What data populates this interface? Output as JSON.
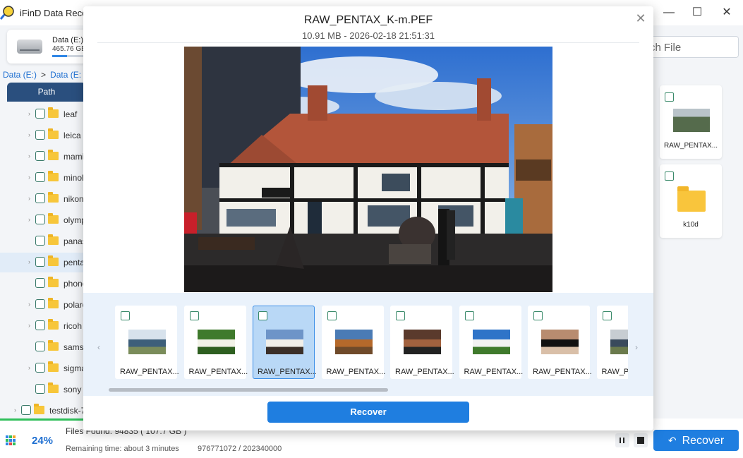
{
  "app": {
    "title": "iFinD Data Recov",
    "window_controls": {
      "minimize": "—",
      "maximize": "☐",
      "close": "✕"
    }
  },
  "drive": {
    "name": "Data (E:)",
    "size": "465.76 GB",
    "usage_fraction": 0.35
  },
  "breadcrumb": {
    "root": "Data (E:)",
    "separator": ">",
    "current": "Data (E:"
  },
  "tabs": {
    "path": "Path"
  },
  "tree": {
    "items": [
      {
        "label": "leaf",
        "selected": false,
        "expandable": true
      },
      {
        "label": "leica",
        "selected": false,
        "expandable": true
      },
      {
        "label": "mami",
        "selected": false,
        "expandable": true
      },
      {
        "label": "minol",
        "selected": false,
        "expandable": true
      },
      {
        "label": "nikon",
        "selected": false,
        "expandable": true
      },
      {
        "label": "olymp",
        "selected": false,
        "expandable": true
      },
      {
        "label": "panas",
        "selected": false,
        "expandable": false
      },
      {
        "label": "penta",
        "selected": true,
        "expandable": true
      },
      {
        "label": "phone",
        "selected": false,
        "expandable": false
      },
      {
        "label": "polarc",
        "selected": false,
        "expandable": true
      },
      {
        "label": "ricoh",
        "selected": false,
        "expandable": true
      },
      {
        "label": "samsu",
        "selected": false,
        "expandable": false
      },
      {
        "label": "sigma",
        "selected": false,
        "expandable": true
      },
      {
        "label": "sony",
        "selected": false,
        "expandable": false
      }
    ],
    "root_item": {
      "label": "testdisk-7",
      "expandable": true
    }
  },
  "search": {
    "placeholder": "ch File"
  },
  "right_panel": {
    "items": [
      {
        "name": "RAW_PENTAX...",
        "kind": "image"
      },
      {
        "name": "k10d",
        "kind": "folder"
      }
    ]
  },
  "status": {
    "percent": "24%",
    "progress_fraction": 0.24,
    "files_found": "Files Found:  94835 ( 107.7 GB )",
    "remaining": "Remaining time: about  3  minutes",
    "sectors": "976771072 / 202340000",
    "recover_label": "Recover",
    "undo_icon": "↶"
  },
  "preview": {
    "title": "RAW_PENTAX_K-m.PEF",
    "meta": "10.91 MB   -   2026-02-18 21:51:31",
    "close_icon": "✕",
    "recover_label": "Recover",
    "prev_arrow": "‹",
    "next_arrow": "›",
    "thumbnails": [
      {
        "name": "RAW_PENTAX...",
        "active": false,
        "palette": [
          "#d7e2ec",
          "#3d5f7a",
          "#7a8c5a"
        ]
      },
      {
        "name": "RAW_PENTAX...",
        "active": false,
        "palette": [
          "#3f7a2c",
          "#f2f2e8",
          "#2e5f20"
        ]
      },
      {
        "name": "RAW_PENTAX...",
        "active": true,
        "palette": [
          "#6d94c8",
          "#f1efe9",
          "#3b2f28"
        ]
      },
      {
        "name": "RAW_PENTAX...",
        "active": false,
        "palette": [
          "#4a7bb5",
          "#b5692b",
          "#6f4a2a"
        ]
      },
      {
        "name": "RAW_PENTAX...",
        "active": false,
        "palette": [
          "#5a3a2c",
          "#a2623f",
          "#222222"
        ]
      },
      {
        "name": "RAW_PENTAX...",
        "active": false,
        "palette": [
          "#2f74c8",
          "#f2f2f2",
          "#3f7a2c"
        ]
      },
      {
        "name": "RAW_PENTAX...",
        "active": false,
        "palette": [
          "#b88c70",
          "#111111",
          "#d9bfa8"
        ]
      },
      {
        "name": "RAW_PE",
        "active": false,
        "palette": [
          "#c7cdd2",
          "#394a5c",
          "#6a7a4c"
        ]
      }
    ]
  },
  "colors": {
    "accent": "#1f7ee0",
    "sidebar_tab": "#2a4f7e",
    "folder": "#f7c63a",
    "progress_green": "#2fbf5a"
  }
}
